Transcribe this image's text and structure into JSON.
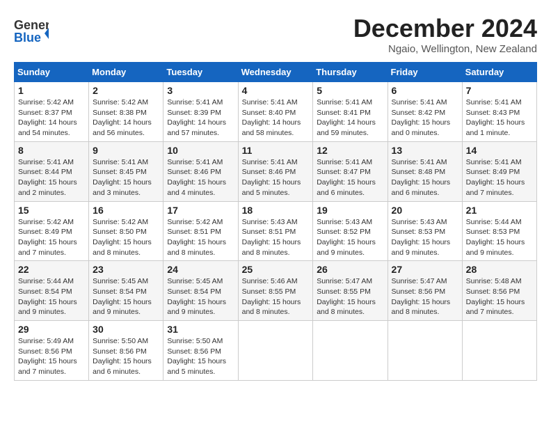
{
  "header": {
    "logo_line1": "General",
    "logo_line2": "Blue",
    "month": "December 2024",
    "location": "Ngaio, Wellington, New Zealand"
  },
  "weekdays": [
    "Sunday",
    "Monday",
    "Tuesday",
    "Wednesday",
    "Thursday",
    "Friday",
    "Saturday"
  ],
  "weeks": [
    [
      {
        "day": "1",
        "info": "Sunrise: 5:42 AM\nSunset: 8:37 PM\nDaylight: 14 hours\nand 54 minutes."
      },
      {
        "day": "2",
        "info": "Sunrise: 5:42 AM\nSunset: 8:38 PM\nDaylight: 14 hours\nand 56 minutes."
      },
      {
        "day": "3",
        "info": "Sunrise: 5:41 AM\nSunset: 8:39 PM\nDaylight: 14 hours\nand 57 minutes."
      },
      {
        "day": "4",
        "info": "Sunrise: 5:41 AM\nSunset: 8:40 PM\nDaylight: 14 hours\nand 58 minutes."
      },
      {
        "day": "5",
        "info": "Sunrise: 5:41 AM\nSunset: 8:41 PM\nDaylight: 14 hours\nand 59 minutes."
      },
      {
        "day": "6",
        "info": "Sunrise: 5:41 AM\nSunset: 8:42 PM\nDaylight: 15 hours\nand 0 minutes."
      },
      {
        "day": "7",
        "info": "Sunrise: 5:41 AM\nSunset: 8:43 PM\nDaylight: 15 hours\nand 1 minute."
      }
    ],
    [
      {
        "day": "8",
        "info": "Sunrise: 5:41 AM\nSunset: 8:44 PM\nDaylight: 15 hours\nand 2 minutes."
      },
      {
        "day": "9",
        "info": "Sunrise: 5:41 AM\nSunset: 8:45 PM\nDaylight: 15 hours\nand 3 minutes."
      },
      {
        "day": "10",
        "info": "Sunrise: 5:41 AM\nSunset: 8:46 PM\nDaylight: 15 hours\nand 4 minutes."
      },
      {
        "day": "11",
        "info": "Sunrise: 5:41 AM\nSunset: 8:46 PM\nDaylight: 15 hours\nand 5 minutes."
      },
      {
        "day": "12",
        "info": "Sunrise: 5:41 AM\nSunset: 8:47 PM\nDaylight: 15 hours\nand 6 minutes."
      },
      {
        "day": "13",
        "info": "Sunrise: 5:41 AM\nSunset: 8:48 PM\nDaylight: 15 hours\nand 6 minutes."
      },
      {
        "day": "14",
        "info": "Sunrise: 5:41 AM\nSunset: 8:49 PM\nDaylight: 15 hours\nand 7 minutes."
      }
    ],
    [
      {
        "day": "15",
        "info": "Sunrise: 5:42 AM\nSunset: 8:49 PM\nDaylight: 15 hours\nand 7 minutes."
      },
      {
        "day": "16",
        "info": "Sunrise: 5:42 AM\nSunset: 8:50 PM\nDaylight: 15 hours\nand 8 minutes."
      },
      {
        "day": "17",
        "info": "Sunrise: 5:42 AM\nSunset: 8:51 PM\nDaylight: 15 hours\nand 8 minutes."
      },
      {
        "day": "18",
        "info": "Sunrise: 5:43 AM\nSunset: 8:51 PM\nDaylight: 15 hours\nand 8 minutes."
      },
      {
        "day": "19",
        "info": "Sunrise: 5:43 AM\nSunset: 8:52 PM\nDaylight: 15 hours\nand 9 minutes."
      },
      {
        "day": "20",
        "info": "Sunrise: 5:43 AM\nSunset: 8:53 PM\nDaylight: 15 hours\nand 9 minutes."
      },
      {
        "day": "21",
        "info": "Sunrise: 5:44 AM\nSunset: 8:53 PM\nDaylight: 15 hours\nand 9 minutes."
      }
    ],
    [
      {
        "day": "22",
        "info": "Sunrise: 5:44 AM\nSunset: 8:54 PM\nDaylight: 15 hours\nand 9 minutes."
      },
      {
        "day": "23",
        "info": "Sunrise: 5:45 AM\nSunset: 8:54 PM\nDaylight: 15 hours\nand 9 minutes."
      },
      {
        "day": "24",
        "info": "Sunrise: 5:45 AM\nSunset: 8:54 PM\nDaylight: 15 hours\nand 9 minutes."
      },
      {
        "day": "25",
        "info": "Sunrise: 5:46 AM\nSunset: 8:55 PM\nDaylight: 15 hours\nand 8 minutes."
      },
      {
        "day": "26",
        "info": "Sunrise: 5:47 AM\nSunset: 8:55 PM\nDaylight: 15 hours\nand 8 minutes."
      },
      {
        "day": "27",
        "info": "Sunrise: 5:47 AM\nSunset: 8:56 PM\nDaylight: 15 hours\nand 8 minutes."
      },
      {
        "day": "28",
        "info": "Sunrise: 5:48 AM\nSunset: 8:56 PM\nDaylight: 15 hours\nand 7 minutes."
      }
    ],
    [
      {
        "day": "29",
        "info": "Sunrise: 5:49 AM\nSunset: 8:56 PM\nDaylight: 15 hours\nand 7 minutes."
      },
      {
        "day": "30",
        "info": "Sunrise: 5:50 AM\nSunset: 8:56 PM\nDaylight: 15 hours\nand 6 minutes."
      },
      {
        "day": "31",
        "info": "Sunrise: 5:50 AM\nSunset: 8:56 PM\nDaylight: 15 hours\nand 5 minutes."
      },
      null,
      null,
      null,
      null
    ]
  ]
}
